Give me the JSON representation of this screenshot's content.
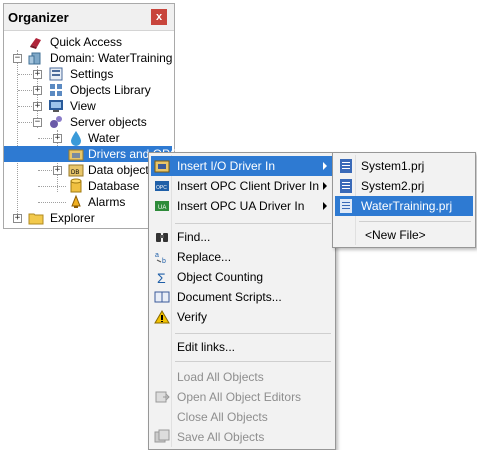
{
  "organizer": {
    "title": "Organizer",
    "close_label": "x",
    "tree": {
      "quick_access": "Quick Access",
      "domain": "Domain: WaterTraining",
      "settings": "Settings",
      "objects_library": "Objects Library",
      "view": "View",
      "server_objects": "Server objects",
      "water": "Water",
      "drivers_and_opc": "Drivers and OPC",
      "data_objects": "Data objects",
      "database": "Database",
      "alarms": "Alarms",
      "explorer": "Explorer"
    }
  },
  "context_menu": {
    "insert_io_driver": "Insert I/O Driver In",
    "insert_opc_client": "Insert OPC Client Driver In",
    "insert_opc_ua": "Insert OPC UA Driver In",
    "find": "Find...",
    "replace": "Replace...",
    "object_counting": "Object Counting",
    "document_scripts": "Document Scripts...",
    "verify": "Verify",
    "edit_links": "Edit links...",
    "load_all_objects": "Load All Objects",
    "open_all_object_editors": "Open All Object Editors",
    "close_all_objects": "Close All Objects",
    "save_all_objects": "Save All Objects"
  },
  "submenu": {
    "files": [
      "System1.prj",
      "System2.prj",
      "WaterTraining.prj"
    ],
    "new_file": "<New File>"
  },
  "colors": {
    "selection": "#2e7ad2",
    "close_button": "#c8453c",
    "menu_background": "#f2f2f2"
  }
}
